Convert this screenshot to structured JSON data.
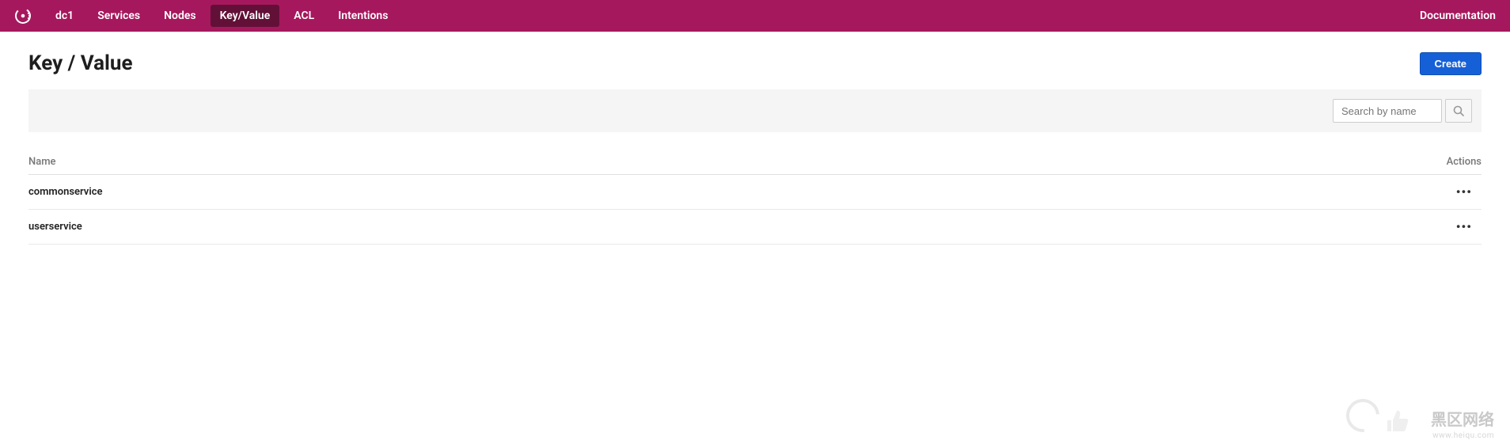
{
  "nav": {
    "datacenter": "dc1",
    "items": [
      {
        "label": "Services",
        "active": false
      },
      {
        "label": "Nodes",
        "active": false
      },
      {
        "label": "Key/Value",
        "active": true
      },
      {
        "label": "ACL",
        "active": false
      },
      {
        "label": "Intentions",
        "active": false
      }
    ],
    "documentation": "Documentation"
  },
  "page": {
    "title": "Key / Value",
    "create_label": "Create"
  },
  "search": {
    "placeholder": "Search by name"
  },
  "table": {
    "header_name": "Name",
    "header_actions": "Actions",
    "rows": [
      {
        "name": "commonservice"
      },
      {
        "name": "userservice"
      }
    ]
  },
  "watermark": {
    "text": "黑区网络",
    "sub": "www.heiqu.com"
  }
}
